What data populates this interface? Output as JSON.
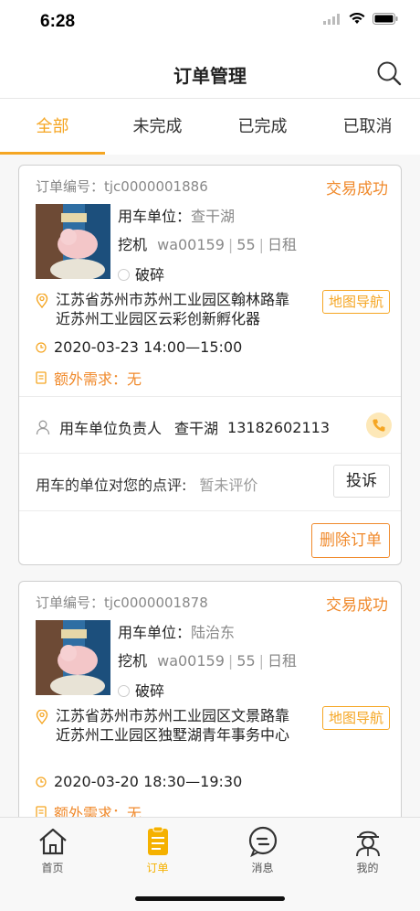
{
  "status_bar": {
    "time": "6:28"
  },
  "nav": {
    "title": "订单管理"
  },
  "tabs": [
    {
      "label": "全部",
      "active": true
    },
    {
      "label": "未完成",
      "active": false
    },
    {
      "label": "已完成",
      "active": false
    },
    {
      "label": "已取消",
      "active": false
    }
  ],
  "orders": [
    {
      "order_no": "订单编号：tjc0000001886",
      "status": "交易成功",
      "unit_label": "用车单位：",
      "unit_name": "查干湖",
      "machine": "挖机",
      "machine_code": "wa00159",
      "machine_size": "55",
      "rent_type": "日租",
      "service": "破碎",
      "address": "江苏省苏州市苏州工业园区翰林路靠近苏州工业园区云彩创新孵化器",
      "map_button": "地图导航",
      "time": "2020-03-23 14:00—15:00",
      "extra": "额外需求：无",
      "contact_label": "用车单位负责人",
      "contact_name": "查干湖",
      "contact_phone": "13182602113",
      "review_label": "用车的单位对您的点评:",
      "review_value": "暂未评价",
      "complain_button": "投诉",
      "delete_button": "删除订单"
    },
    {
      "order_no": "订单编号：tjc0000001878",
      "status": "交易成功",
      "unit_label": "用车单位：",
      "unit_name": "陆治东",
      "machine": "挖机",
      "machine_code": "wa00159",
      "machine_size": "55",
      "rent_type": "日租",
      "service": "破碎",
      "address": "江苏省苏州市苏州工业园区文景路靠近苏州工业园区独墅湖青年事务中心",
      "map_button": "地图导航",
      "time": "2020-03-20 18:30—19:30",
      "extra": "额外需求：无"
    }
  ],
  "tabbar": [
    {
      "label": "首页",
      "icon": "home-icon",
      "active": false
    },
    {
      "label": "订单",
      "icon": "order-icon",
      "active": true
    },
    {
      "label": "消息",
      "icon": "message-icon",
      "active": false
    },
    {
      "label": "我的",
      "icon": "profile-icon",
      "active": false
    }
  ],
  "colors": {
    "accent": "#f5a623",
    "status": "#f08a2c"
  }
}
